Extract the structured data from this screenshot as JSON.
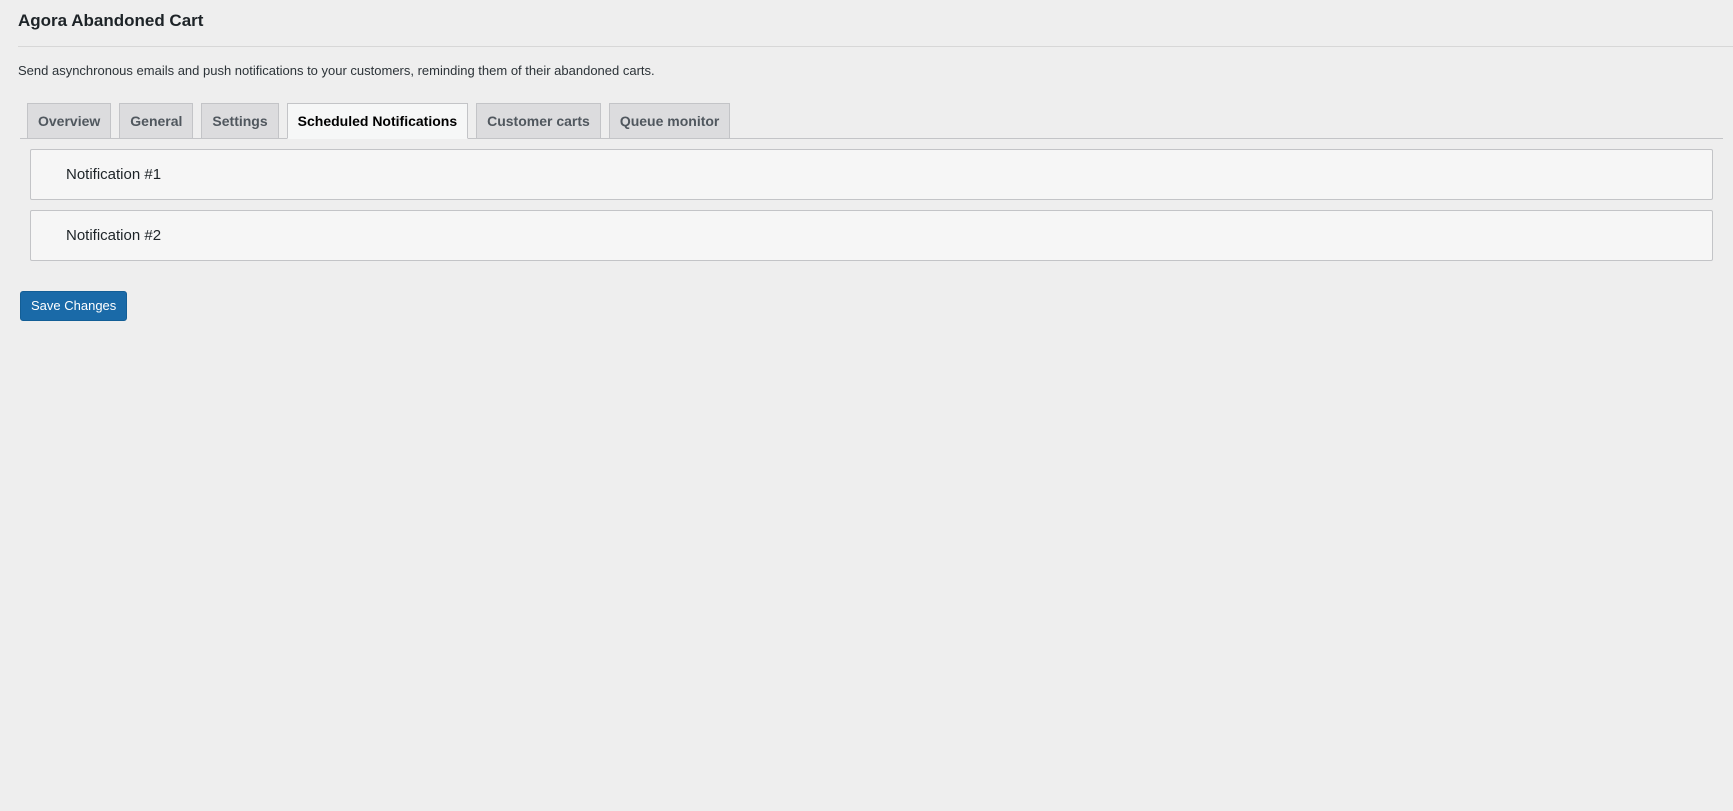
{
  "header": {
    "title": "Agora Abandoned Cart",
    "description": "Send asynchronous emails and push notifications to your customers, reminding them of their abandoned carts."
  },
  "tabs": [
    {
      "label": "Overview",
      "active": false
    },
    {
      "label": "General",
      "active": false
    },
    {
      "label": "Settings",
      "active": false
    },
    {
      "label": "Scheduled Notifications",
      "active": true
    },
    {
      "label": "Customer carts",
      "active": false
    },
    {
      "label": "Queue monitor",
      "active": false
    }
  ],
  "notifications": [
    {
      "label": "Notification #1"
    },
    {
      "label": "Notification #2"
    }
  ],
  "actions": {
    "save_label": "Save Changes"
  },
  "colors": {
    "background": "#eeeeee",
    "primary_button": "#1a6aa8",
    "tab_inactive": "#dcdcde",
    "tab_active": "#f6f7f7"
  }
}
